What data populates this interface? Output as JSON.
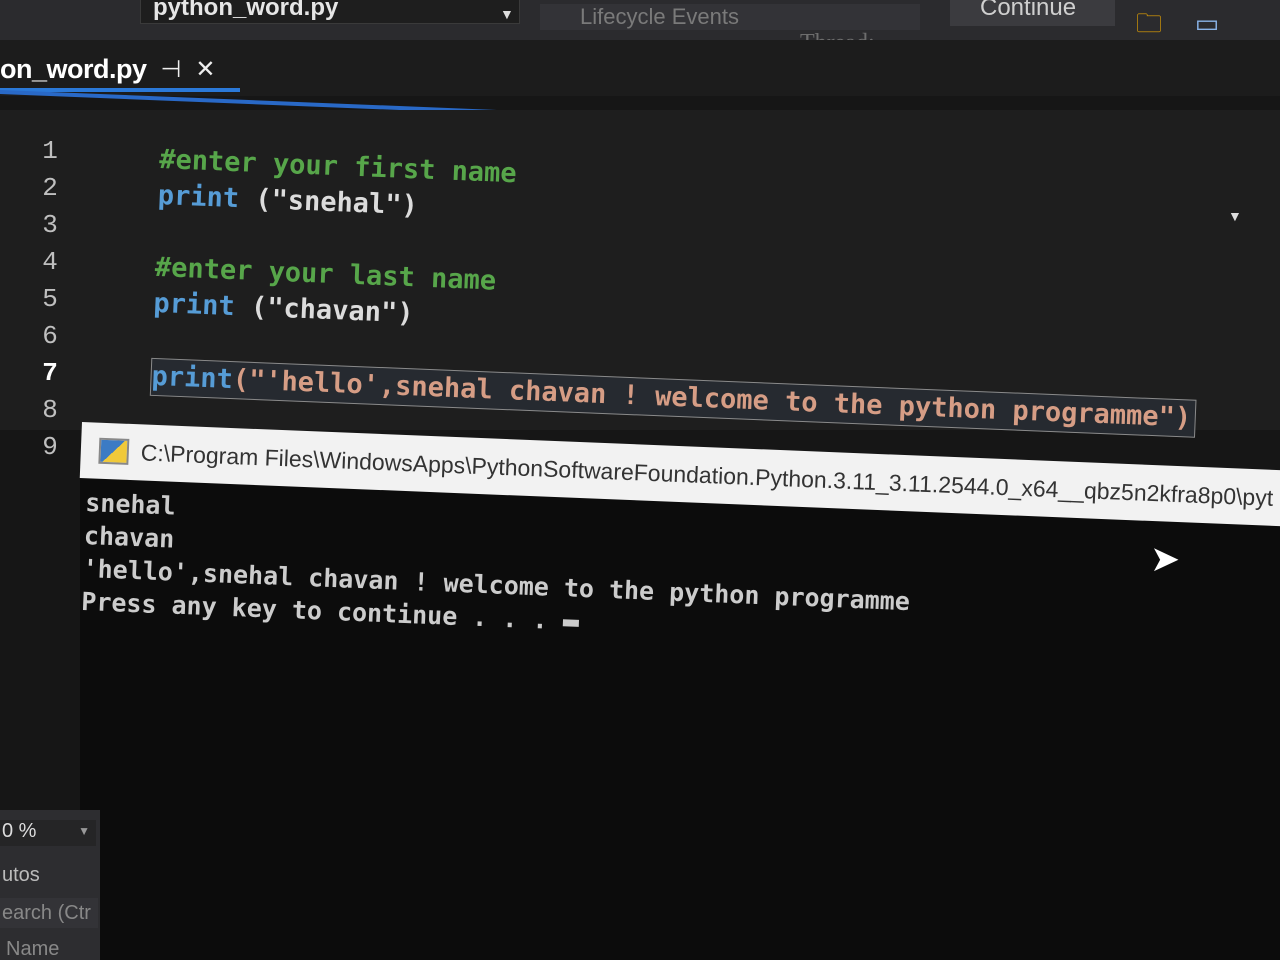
{
  "toolbar": {
    "file_combo": "python_word.py",
    "lifecycle_placeholder": "Lifecycle Events",
    "thread_label": "Thread:",
    "continue_label": "Continue"
  },
  "tab": {
    "filename": "on_word.py",
    "pin_glyph": "⊣",
    "close_glyph": "✕"
  },
  "editor": {
    "line_numbers": [
      "1",
      "2",
      "3",
      "4",
      "5",
      "6",
      "7",
      "8",
      "9"
    ],
    "current_line": "7",
    "lines": {
      "l1": "#enter your first name",
      "l2_kw": "print",
      "l2_str": "(\"snehal\")",
      "l4": "#enter your last name",
      "l5_kw": "print",
      "l5_str": "(\"chavan\")",
      "l7_kw": "print",
      "l7_str": "(\"'hello',snehal chavan ! welcome to the python programme\")"
    }
  },
  "console": {
    "title": "C:\\Program Files\\WindowsApps\\PythonSoftwareFoundation.Python.3.11_3.11.2544.0_x64__qbz5n2kfra8p0\\pyt",
    "output": [
      "snehal",
      "chavan",
      "'hello',snehal chavan ! welcome to the python programme",
      "Press any key to continue . . . "
    ]
  },
  "left_panel": {
    "zoom": "0 %",
    "autos": "utos",
    "search_placeholder": "earch (Ctr",
    "name_header": "Name"
  },
  "colors": {
    "comment": "#57a64a",
    "keyword": "#569cd6",
    "string": "#d69d85",
    "accent_blue": "#2969c7"
  },
  "icons": [
    "pin-icon",
    "close-icon",
    "python-icon",
    "mouse-pointer-icon",
    "folder-search-icon",
    "window-icon"
  ]
}
